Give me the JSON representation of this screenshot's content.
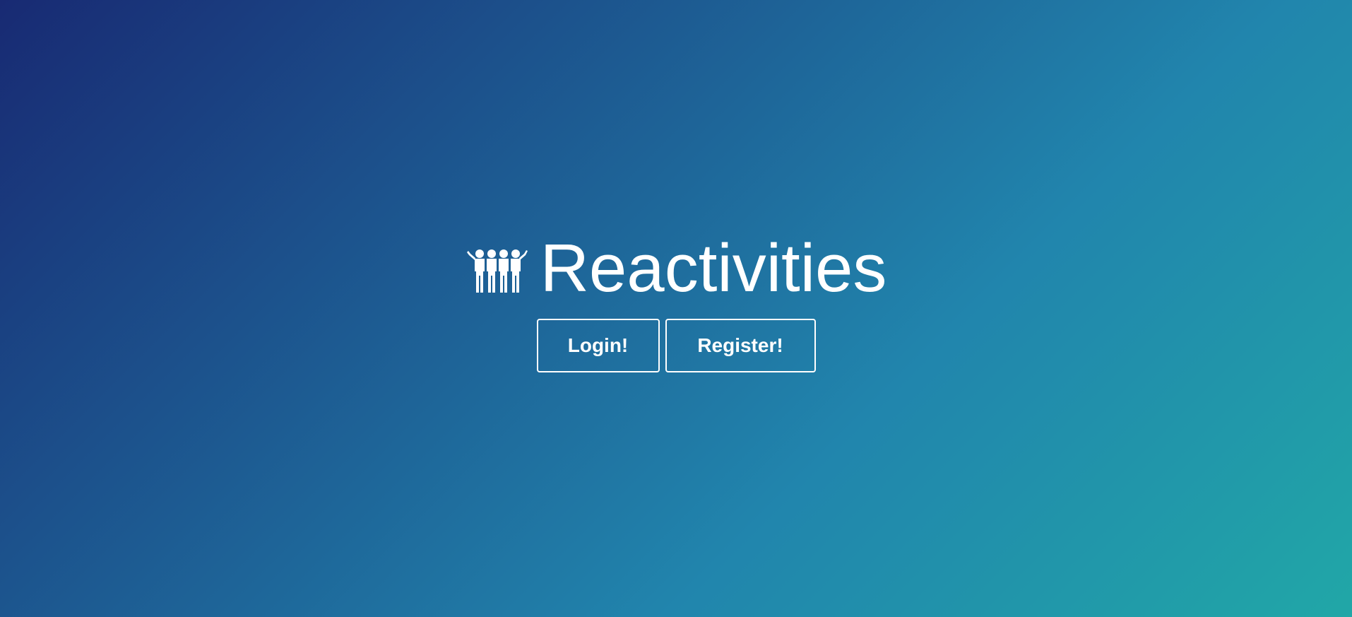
{
  "app": {
    "title": "Reactivities",
    "logo_icon": "group-people-icon"
  },
  "actions": {
    "login_label": "Login!",
    "register_label": "Register!"
  },
  "colors": {
    "gradient_start": "#182a73",
    "gradient_end": "#21a7a7",
    "text": "#ffffff"
  }
}
